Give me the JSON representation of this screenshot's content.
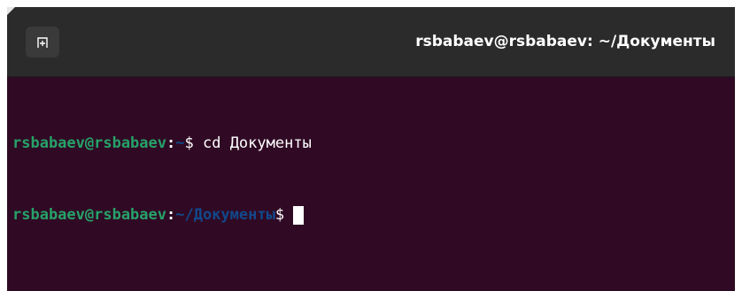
{
  "window": {
    "title": "rsbabaev@rsbabaev: ~/Документы"
  },
  "icons": {
    "new_tab": "new-tab-icon"
  },
  "terminal": {
    "lines": [
      {
        "user_host": "rsbabaev@rsbabaev",
        "separator": ":",
        "path": "~",
        "prompt": "$",
        "command": " cd Документы"
      },
      {
        "user_host": "rsbabaev@rsbabaev",
        "separator": ":",
        "path": "~/Документы",
        "prompt": "$",
        "command": ""
      }
    ]
  },
  "colors": {
    "background": "#300a24",
    "titlebar": "#2b2b2b",
    "user_host": "#26a269",
    "path": "#12488b",
    "text": "#ffffff"
  }
}
